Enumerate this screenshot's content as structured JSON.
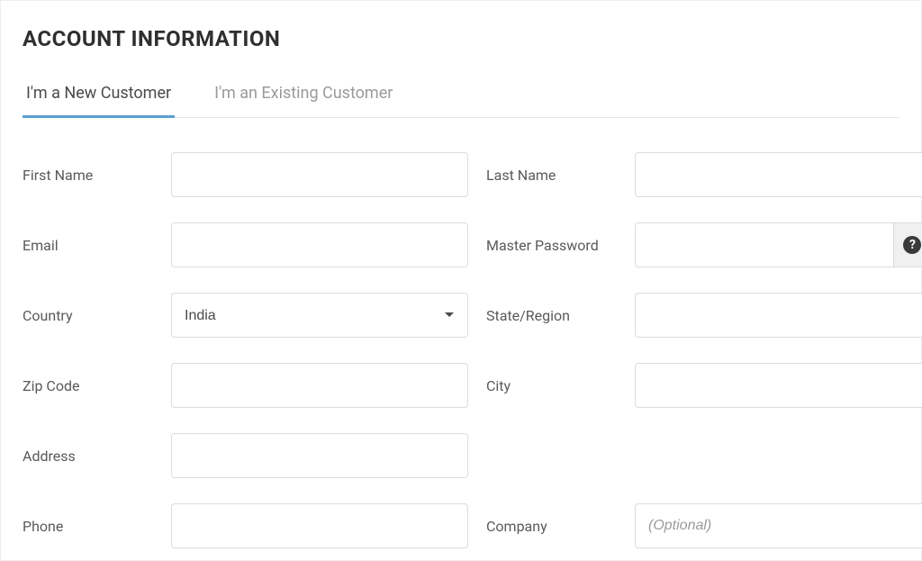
{
  "title": "ACCOUNT INFORMATION",
  "tabs": {
    "new": "I'm a New Customer",
    "existing": "I'm an Existing Customer"
  },
  "labels": {
    "first_name": "First Name",
    "last_name": "Last Name",
    "email": "Email",
    "master_password": "Master Password",
    "country": "Country",
    "state_region": "State/Region",
    "zip_code": "Zip Code",
    "city": "City",
    "address": "Address",
    "phone": "Phone",
    "company": "Company"
  },
  "values": {
    "first_name": "",
    "last_name": "",
    "email": "",
    "master_password": "",
    "country": "India",
    "state_region": "",
    "zip_code": "",
    "city": "",
    "address": "",
    "phone": "",
    "company": ""
  },
  "placeholders": {
    "company": "(Optional)"
  },
  "help_icon_text": "?"
}
